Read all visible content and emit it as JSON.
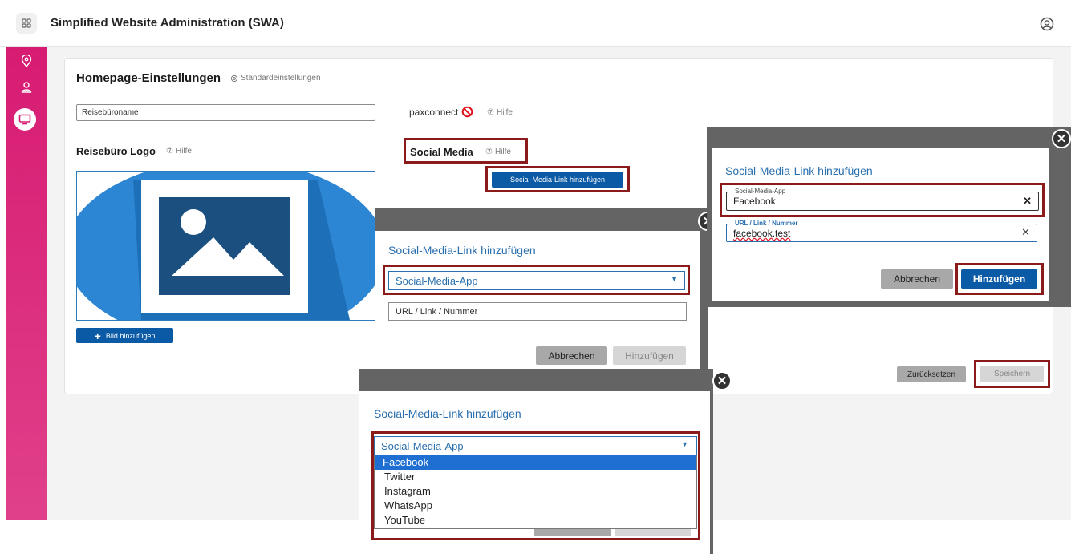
{
  "app": {
    "title": "Simplified Website Administration (SWA)"
  },
  "page": {
    "title": "Homepage-Einstellungen",
    "standard_link": "Standardeinstellungen",
    "name_input_value": "Reisebüroname",
    "paxconnect": "paxconnect",
    "hilfe": "Hilfe",
    "logo_title": "Reisebüro Logo",
    "add_image": "Bild hinzufügen",
    "social_title": "Social Media",
    "add_social_button": "Social-Media-Link hinzufügen",
    "reset_button": "Zurücksetzen",
    "save_button": "Speichern"
  },
  "modal_empty": {
    "title": "Social-Media-Link hinzufügen",
    "select_placeholder": "Social-Media-App",
    "url_placeholder": "URL / Link / Nummer",
    "cancel": "Abbrechen",
    "add": "Hinzufügen"
  },
  "modal_dropdown": {
    "title": "Social-Media-Link hinzufügen",
    "select_placeholder": "Social-Media-App",
    "options": [
      "Facebook",
      "Twitter",
      "Instagram",
      "WhatsApp",
      "YouTube"
    ],
    "highlighted_option": "Facebook",
    "cancel": "Abbrechen",
    "add": "Hinzufügen"
  },
  "modal_filled": {
    "title": "Social-Media-Link hinzufügen",
    "app_label": "Social-Media-App",
    "app_value": "Facebook",
    "url_label": "URL / Link / Nummer",
    "url_value": "facebook.test",
    "cancel": "Abbrechen",
    "add": "Hinzufügen"
  },
  "colors": {
    "accent": "#0b5aa6",
    "sidebar": "#d71b73",
    "highlight": "#8b1a1a",
    "link": "#2a6fae"
  },
  "icons": [
    "apps-icon",
    "user-icon",
    "location-icon",
    "users-icon",
    "monitor-icon",
    "gear-icon",
    "help-icon",
    "blocked-icon",
    "plus-icon",
    "image-icon",
    "chevron-down-icon",
    "close-icon"
  ]
}
